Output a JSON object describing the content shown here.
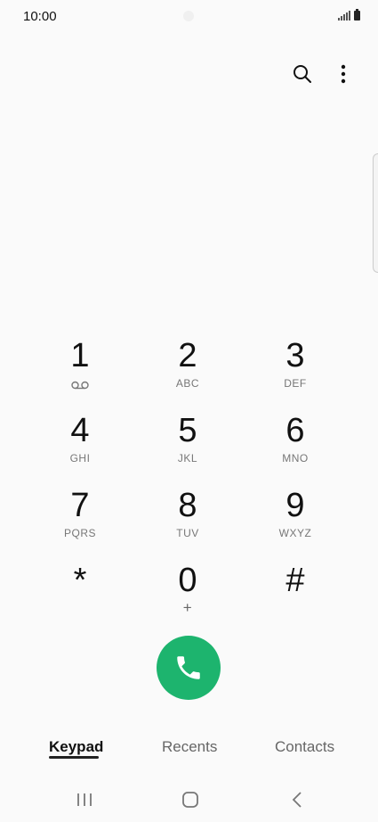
{
  "status_bar": {
    "time": "10:00"
  },
  "top_actions": {
    "search_icon": "search-icon",
    "more_icon": "more-vertical-icon"
  },
  "keypad": [
    [
      {
        "digit": "1",
        "sub": "voicemail-icon"
      },
      {
        "digit": "2",
        "sub": "ABC"
      },
      {
        "digit": "3",
        "sub": "DEF"
      }
    ],
    [
      {
        "digit": "4",
        "sub": "GHI"
      },
      {
        "digit": "5",
        "sub": "JKL"
      },
      {
        "digit": "6",
        "sub": "MNO"
      }
    ],
    [
      {
        "digit": "7",
        "sub": "PQRS"
      },
      {
        "digit": "8",
        "sub": "TUV"
      },
      {
        "digit": "9",
        "sub": "WXYZ"
      }
    ],
    [
      {
        "digit": "*",
        "sub": ""
      },
      {
        "digit": "0",
        "sub": "+"
      },
      {
        "digit": "#",
        "sub": ""
      }
    ]
  ],
  "call_button": {
    "icon": "phone-icon",
    "color": "#1db46e"
  },
  "tabs": {
    "keypad": "Keypad",
    "recents": "Recents",
    "contacts": "Contacts",
    "active": "keypad"
  },
  "nav": {
    "recent_apps": "recent-apps-icon",
    "home": "home-icon",
    "back": "back-icon"
  }
}
